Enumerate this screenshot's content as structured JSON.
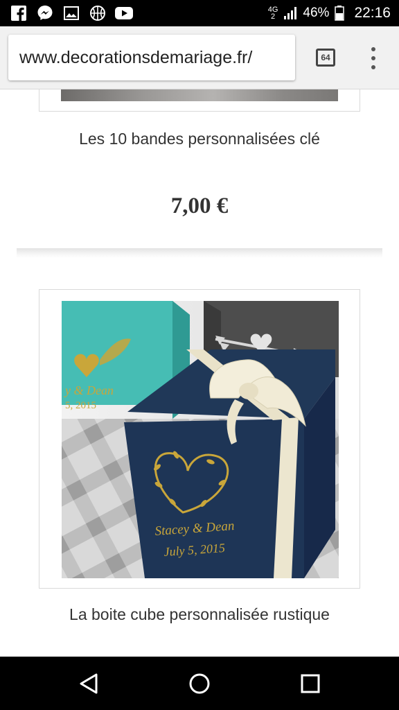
{
  "status_bar": {
    "notification_icons": [
      "facebook-icon",
      "messenger-icon",
      "gallery-icon",
      "basketball-icon",
      "youtube-icon"
    ],
    "network": "4G",
    "network_sub": "2",
    "battery_percent": "46%",
    "time": "22:16"
  },
  "browser": {
    "url": "www.decorationsdemariage.fr/",
    "tab_count": "64"
  },
  "products": [
    {
      "title": "Les 10 bandes personnalisées clé",
      "price": "7,00 €"
    },
    {
      "title": "La boite cube personnalisée rustique"
    }
  ],
  "box_print": {
    "names": "Stacey & Dean",
    "date": "July 5, 2015"
  },
  "colors": {
    "box_navy": "#1f3656",
    "box_teal": "#3fb8b0",
    "box_charcoal": "#4a4a4a",
    "ribbon_cream": "#efe9d2",
    "gold_print": "#c9a63a"
  }
}
